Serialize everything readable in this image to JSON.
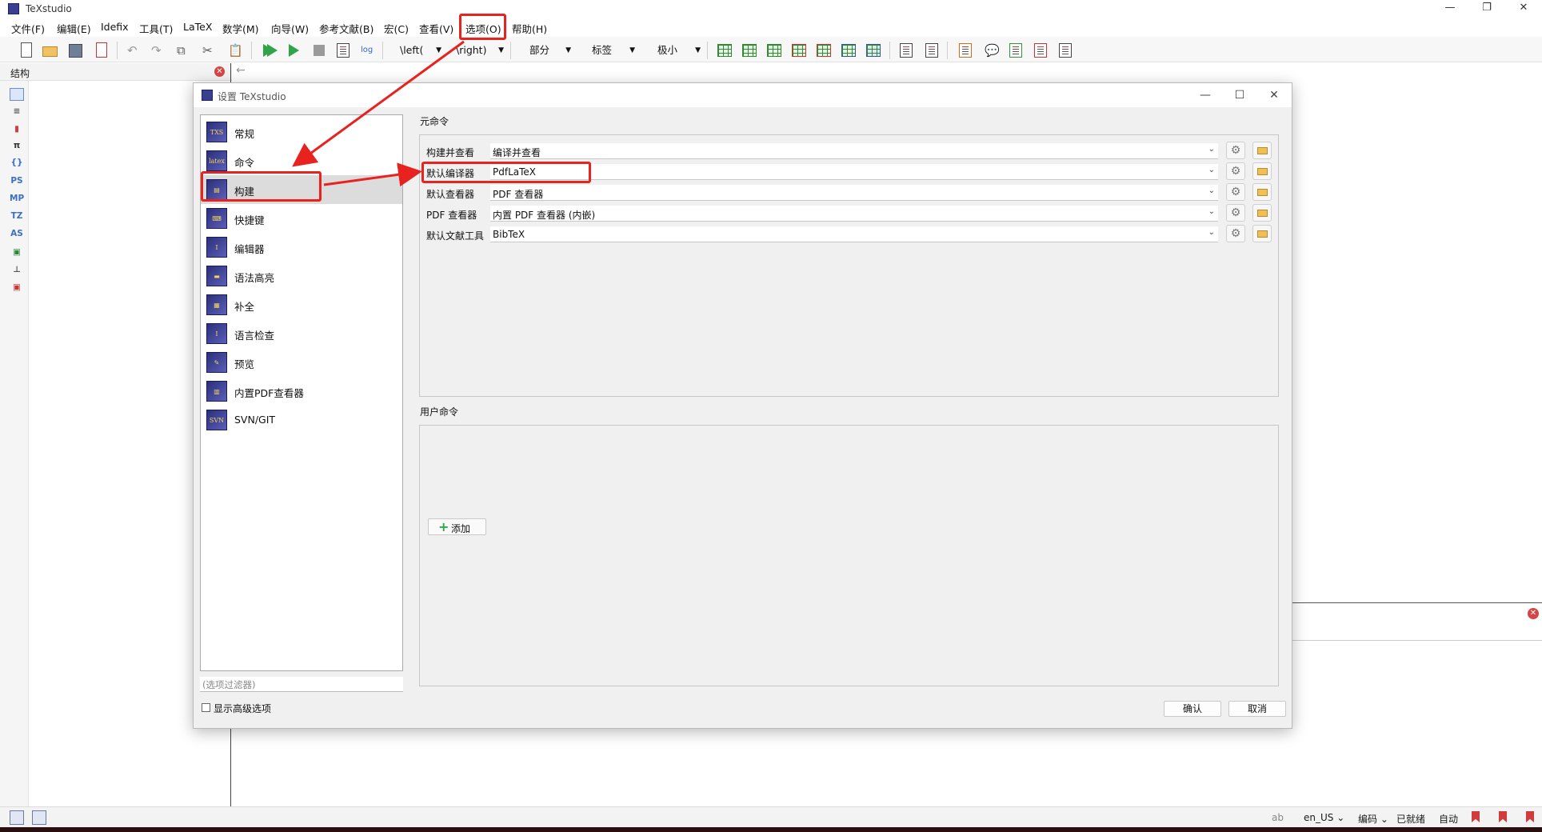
{
  "app": {
    "title": "TeXstudio",
    "window_controls": {
      "minimize": "—",
      "restore": "❐",
      "close": "✕"
    }
  },
  "menubar": [
    "文件(F)",
    "编辑(E)",
    "Idefix",
    "工具(T)",
    "LaTeX",
    "数学(M)",
    "向导(W)",
    "参考文献(B)",
    "宏(C)",
    "查看(V)",
    "选项(O)",
    "帮助(H)"
  ],
  "toolbar": {
    "left_combo": "\\left(",
    "right_combo": "\\right)",
    "section_combo": "部分",
    "label_combo": "标签",
    "size_combo": "极小"
  },
  "structure_panel": {
    "title": "结构",
    "side_icons": [
      "PS",
      "MP",
      "TZ",
      "AS"
    ]
  },
  "dialog": {
    "title": "设置 TeXstudio",
    "categories": [
      {
        "label": "常规",
        "icon": "TXS"
      },
      {
        "label": "命令",
        "icon": "latex"
      },
      {
        "label": "构建",
        "icon": "build"
      },
      {
        "label": "快捷键",
        "icon": "keys"
      },
      {
        "label": "编辑器",
        "icon": "editor"
      },
      {
        "label": "语法高亮",
        "icon": "syntax"
      },
      {
        "label": "补全",
        "icon": "complete"
      },
      {
        "label": "语言检查",
        "icon": "lang"
      },
      {
        "label": "预览",
        "icon": "preview"
      },
      {
        "label": "内置PDF查看器",
        "icon": "pdf"
      },
      {
        "label": "SVN/GIT",
        "icon": "SVN"
      }
    ],
    "selected_category": "构建",
    "filter_placeholder": "(选项过滤器)",
    "show_advanced_label": "显示高级选项",
    "meta_commands": {
      "title": "元命令",
      "rows": [
        {
          "label": "构建并查看",
          "value": "编译并查看"
        },
        {
          "label": "默认编译器",
          "value": "PdfLaTeX"
        },
        {
          "label": "默认查看器",
          "value": "PDF 查看器"
        },
        {
          "label": "PDF 查看器",
          "value": "内置 PDF 查看器 (内嵌)"
        },
        {
          "label": "默认文献工具",
          "value": "BibTeX"
        }
      ]
    },
    "user_commands": {
      "title": "用户命令",
      "add_label": "添加"
    },
    "ok_label": "确认",
    "cancel_label": "取消"
  },
  "statusbar": {
    "language": "en_US",
    "encoding": "编码",
    "status": "已就绪",
    "mode": "自动"
  },
  "colors": {
    "annotation_red": "#e8231f",
    "selected_bg": "#dcdcdc",
    "dialog_bg": "#f0f0f0"
  }
}
